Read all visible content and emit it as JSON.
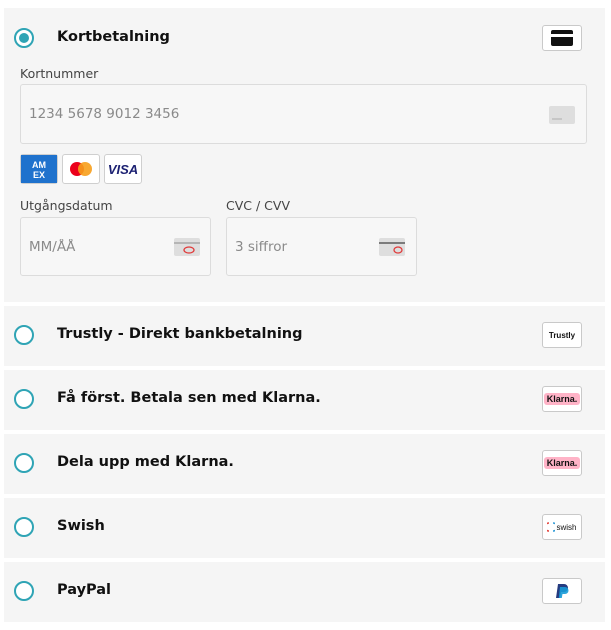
{
  "card_method": {
    "title": "Kortbetalning",
    "card_number": {
      "label": "Kortnummer",
      "placeholder": "1234 5678 9012 3456"
    },
    "brands": [
      "AMEX",
      "Mastercard",
      "VISA"
    ],
    "expiry": {
      "label": "Utgångsdatum",
      "placeholder": "MM/ÅÅ"
    },
    "cvc": {
      "label": "CVC / CVV",
      "placeholder": "3 siffror"
    }
  },
  "methods": [
    {
      "title": "Trustly - Direkt bankbetalning",
      "logo_text": "Trustly",
      "icon": "trustly-logo"
    },
    {
      "title": "Få först. Betala sen med Klarna.",
      "logo_text": "Klarna.",
      "icon": "klarna-logo"
    },
    {
      "title": "Dela upp med Klarna.",
      "logo_text": "Klarna.",
      "icon": "klarna-logo"
    },
    {
      "title": "Swish",
      "logo_text": "swish",
      "icon": "swish-logo"
    },
    {
      "title": "PayPal",
      "logo_text": "",
      "icon": "paypal-logo"
    }
  ],
  "colors": {
    "accent": "#2fa4b5",
    "panel_bg": "#f5f5f5",
    "klarna_pink": "#ffb3c7"
  }
}
